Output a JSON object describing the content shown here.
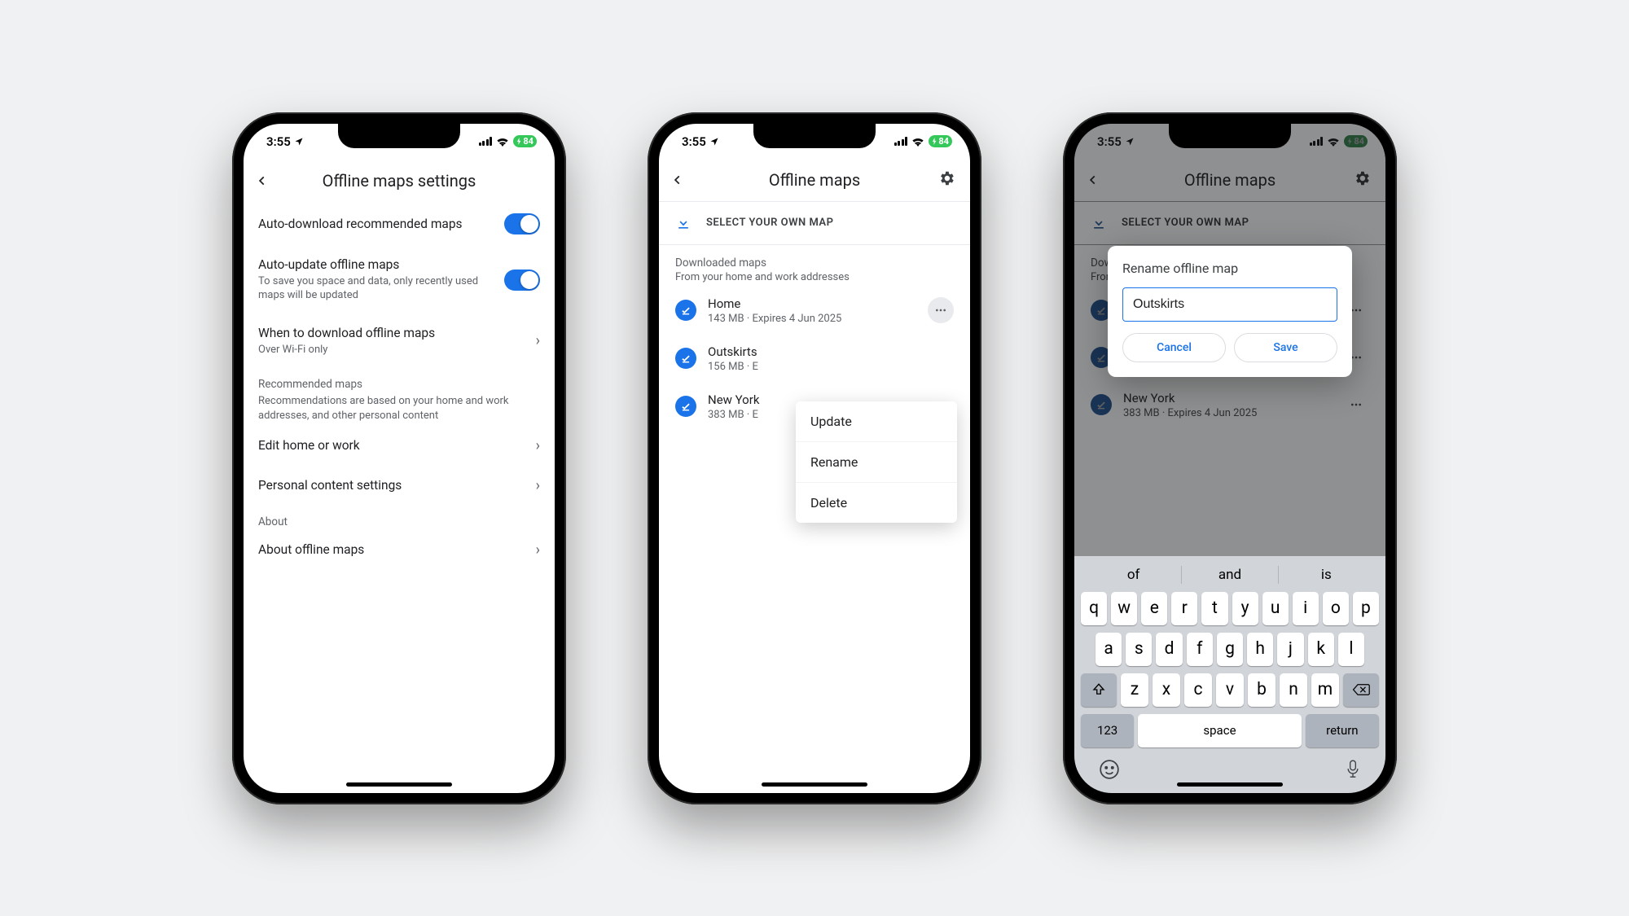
{
  "status": {
    "time": "3:55",
    "battery": "84"
  },
  "phone1": {
    "title": "Offline maps settings",
    "autoDownload": {
      "label": "Auto-download recommended maps"
    },
    "autoUpdate": {
      "label": "Auto-update offline maps",
      "sub": "To save you space and data, only recently used maps will be updated"
    },
    "whenDownload": {
      "label": "When to download offline maps",
      "sub": "Over Wi-Fi only"
    },
    "recommended": {
      "label": "Recommended maps",
      "sub": "Recommendations are based on your home and work addresses, and other personal content"
    },
    "editHome": "Edit home or work",
    "personalContent": "Personal content settings",
    "aboutSection": "About",
    "aboutMaps": "About offline maps"
  },
  "phone2": {
    "title": "Offline maps",
    "selectOwn": "SELECT YOUR OWN MAP",
    "downloaded": {
      "label": "Downloaded maps",
      "sub": "From your home and work addresses"
    },
    "items": [
      {
        "name": "Home",
        "meta": "143 MB · Expires 4 Jun 2025"
      },
      {
        "name": "Outskirts",
        "meta": "156 MB · E"
      },
      {
        "name": "New York",
        "meta": "383 MB · E"
      }
    ],
    "menu": {
      "update": "Update",
      "rename": "Rename",
      "delete": "Delete"
    }
  },
  "phone3": {
    "title": "Offline maps",
    "selectOwn": "SELECT YOUR OWN MAP",
    "downloaded": {
      "label": "Down",
      "sub": "From"
    },
    "items": [
      {
        "name": "",
        "meta": ""
      },
      {
        "name": "",
        "meta": ""
      },
      {
        "name": "New York",
        "meta": "383 MB · Expires 4 Jun 2025"
      }
    ],
    "dialog": {
      "title": "Rename offline map",
      "value": "Outskirts",
      "cancel": "Cancel",
      "save": "Save"
    },
    "keyboard": {
      "suggestions": [
        "of",
        "and",
        "is"
      ],
      "row1": [
        "q",
        "w",
        "e",
        "r",
        "t",
        "y",
        "u",
        "i",
        "o",
        "p"
      ],
      "row2": [
        "a",
        "s",
        "d",
        "f",
        "g",
        "h",
        "j",
        "k",
        "l"
      ],
      "row3": [
        "z",
        "x",
        "c",
        "v",
        "b",
        "n",
        "m"
      ],
      "numKey": "123",
      "spaceKey": "space",
      "returnKey": "return"
    }
  }
}
